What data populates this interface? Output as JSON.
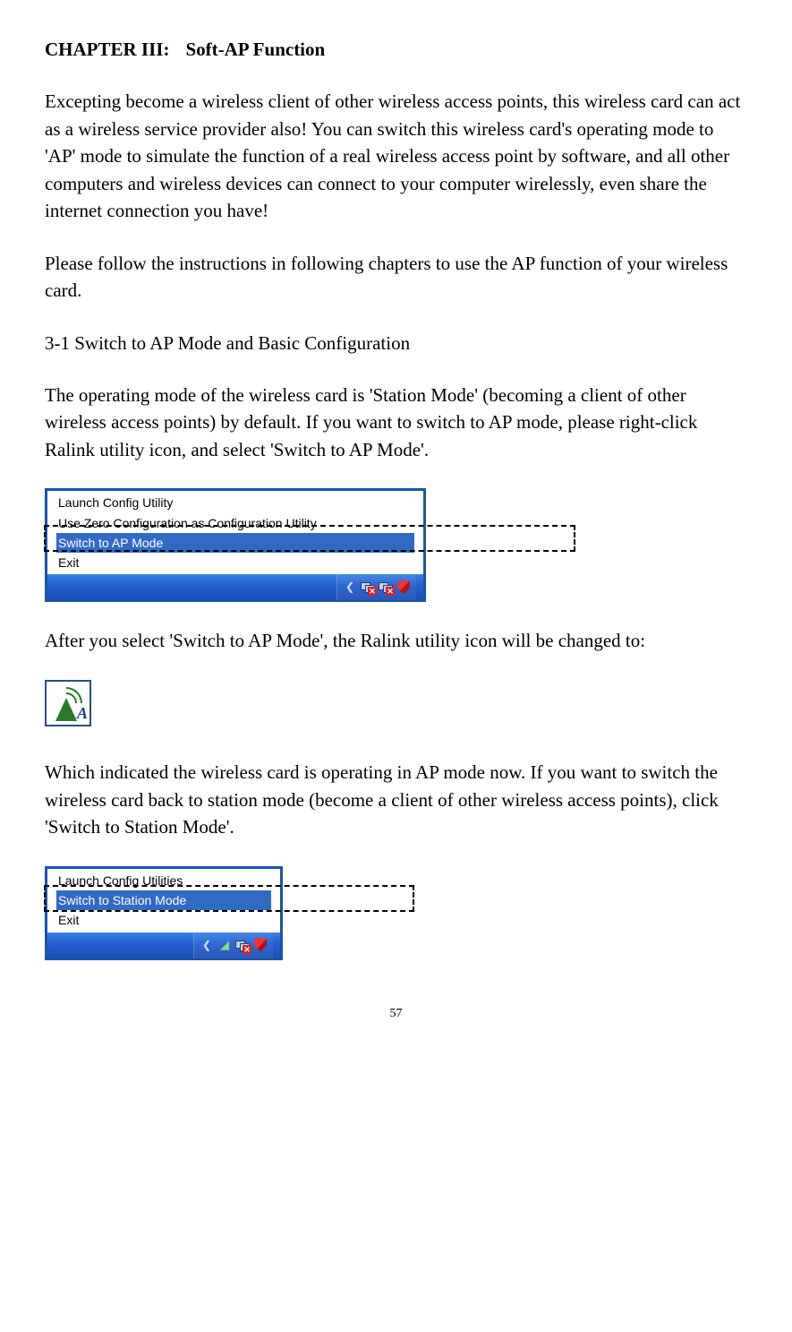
{
  "chapter": {
    "number": "CHAPTER III:",
    "title": "Soft-AP Function"
  },
  "p1": "Excepting become a wireless client of other wireless access points, this wireless card can act as a wireless service provider also! You can switch this wireless card's operating mode to 'AP' mode to simulate the function of a real wireless access point by software, and all other computers and wireless devices can connect to your computer wirelessly, even share the internet connection you have!",
  "p2": "Please follow the instructions in following chapters to use the AP function of your wireless card.",
  "section": "3-1 Switch to AP Mode and Basic Configuration",
  "p3": "The operating mode of the wireless card is 'Station Mode' (becoming a client of other wireless access points) by default. If you want to switch to AP mode, please right-click Ralink utility icon, and select 'Switch to AP Mode'.",
  "menu1": {
    "items": [
      "Launch Config Utility",
      "Use Zero Configuration as Configuration Utility",
      "Switch to AP Mode",
      "Exit"
    ],
    "selectedIndex": 2
  },
  "p4": "After you select 'Switch to AP Mode', the Ralink utility icon will be changed to:",
  "apIconLetter": "A",
  "p5": "Which indicated the wireless card is operating in AP mode now. If you want to switch the wireless card back to station mode (become a client of other wireless access points), click 'Switch to Station Mode'.",
  "menu2": {
    "items": [
      "Launch Config Utilities",
      "Switch to Station Mode",
      "Exit"
    ],
    "selectedIndex": 1
  },
  "pageNumber": "57"
}
